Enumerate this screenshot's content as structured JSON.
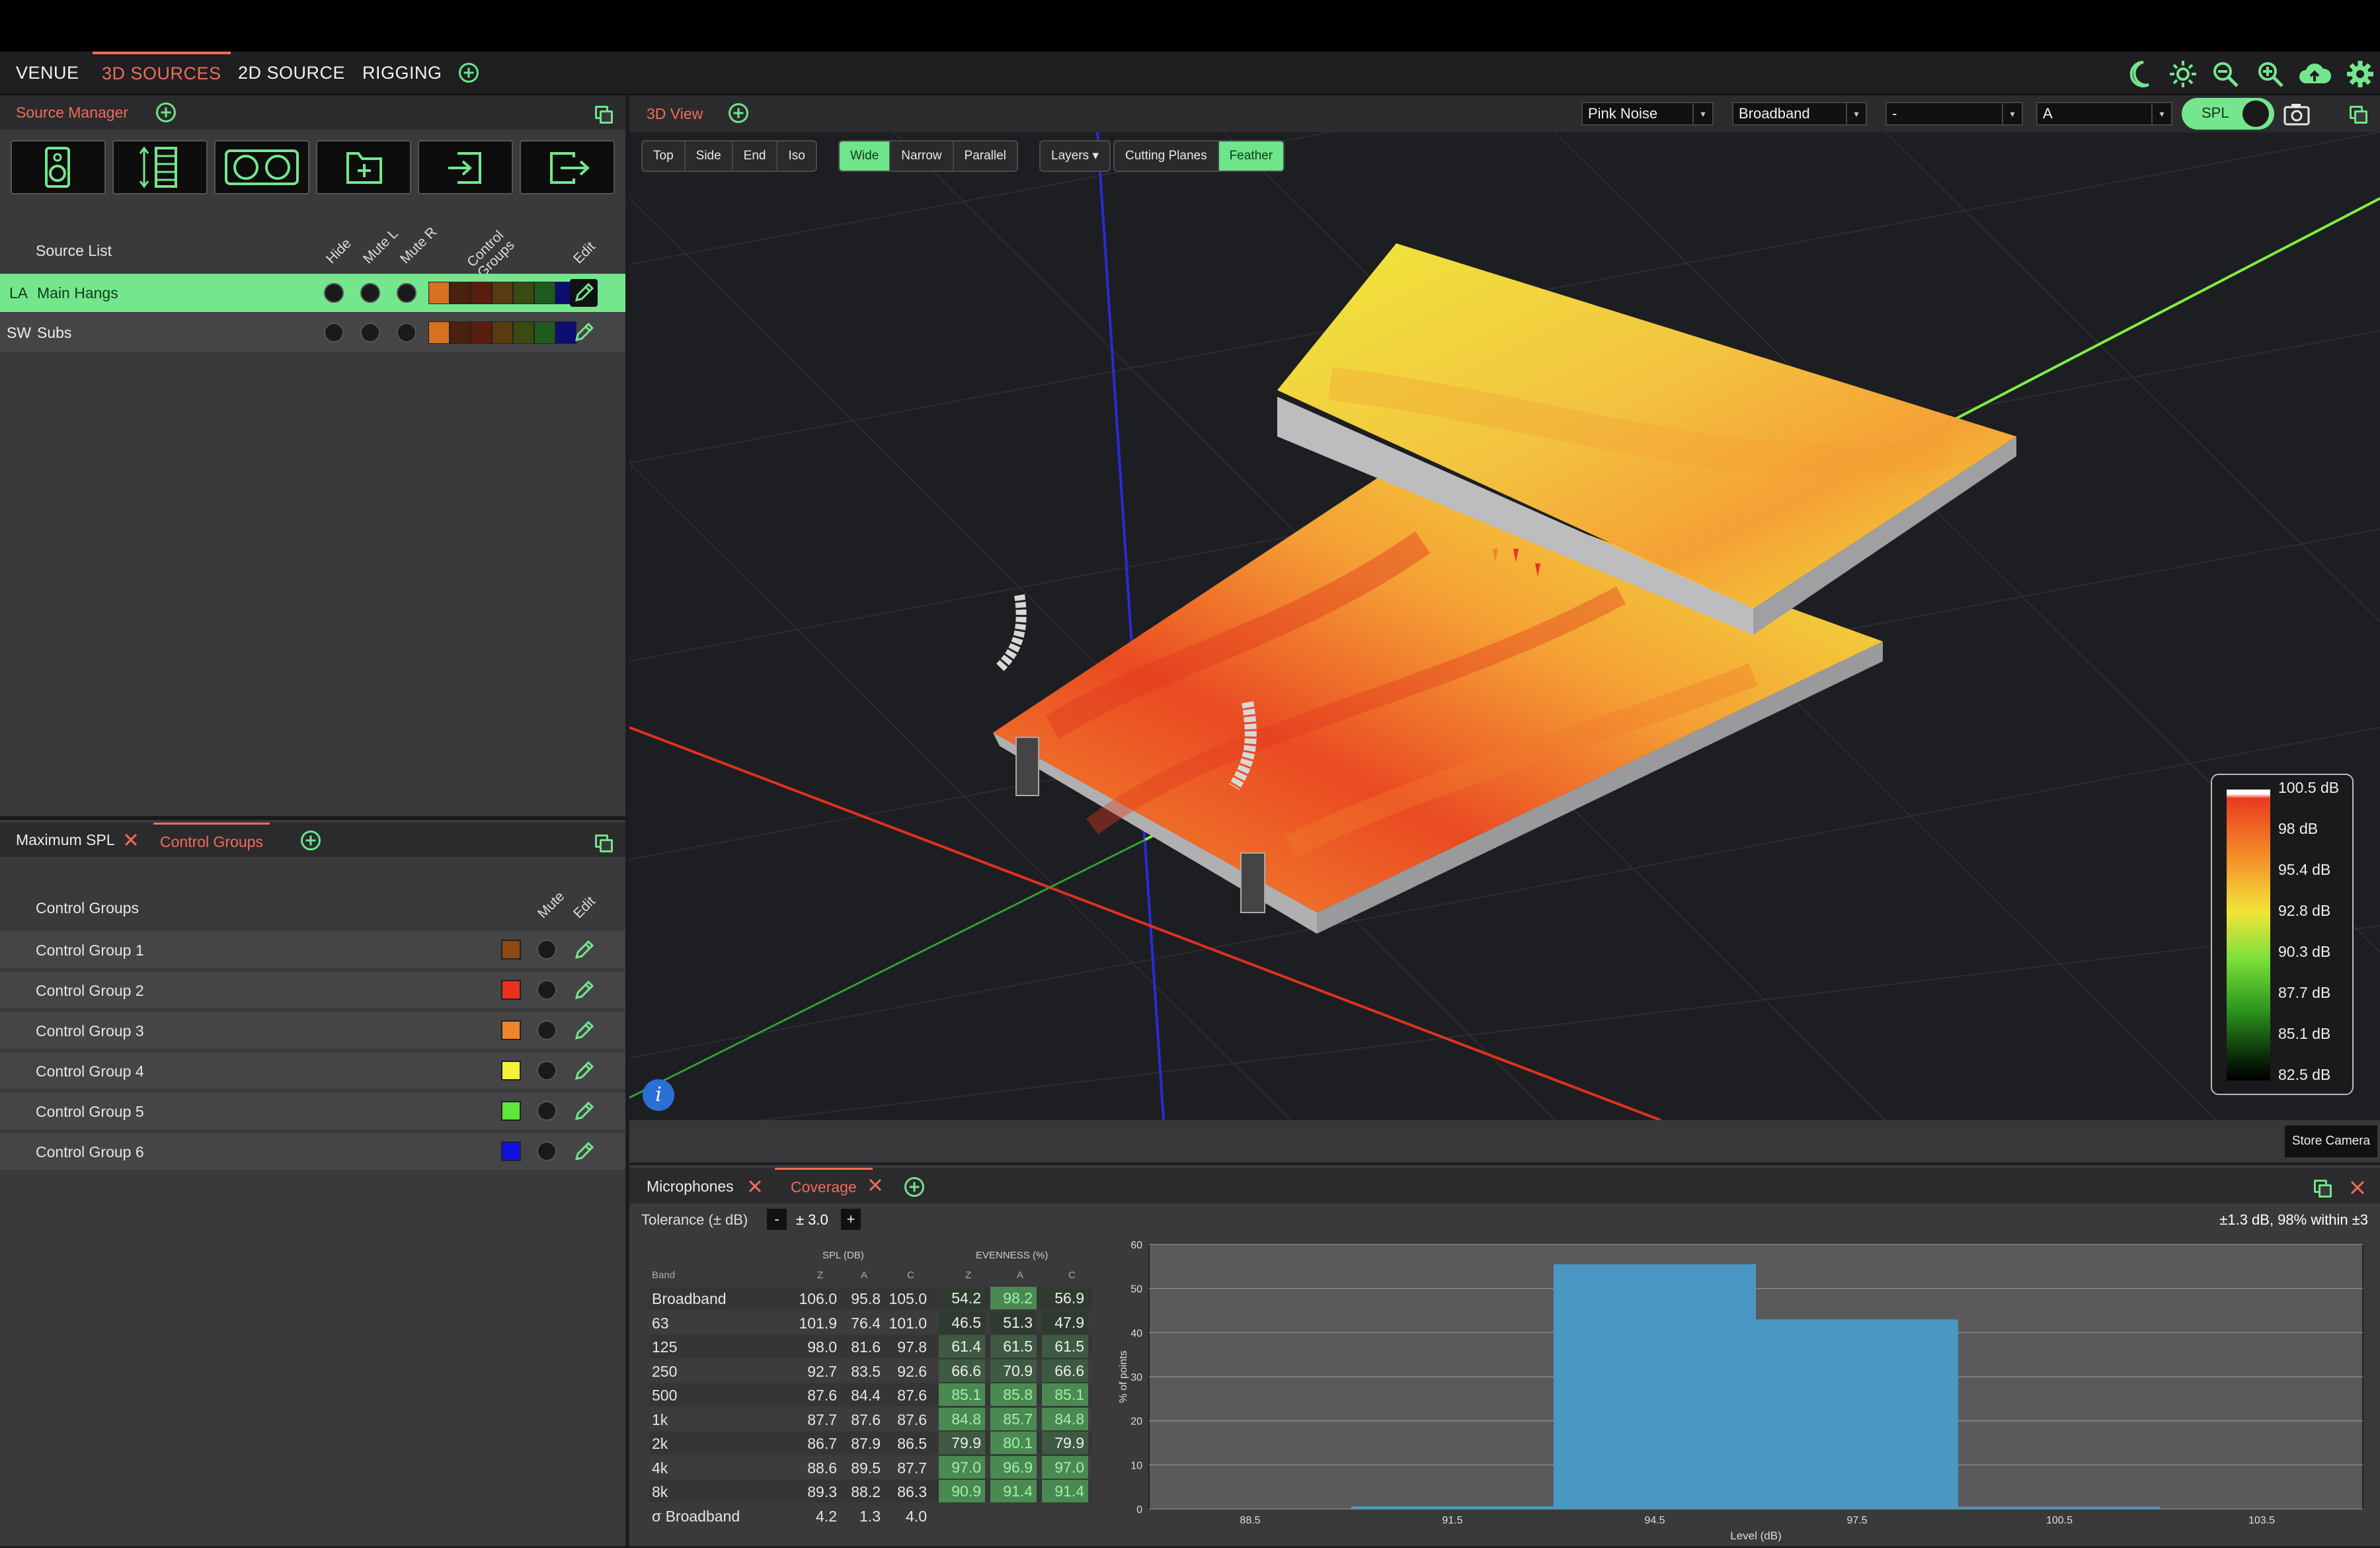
{
  "menu": {
    "items": [
      "VENUE",
      "3D SOURCES",
      "2D SOURCE",
      "RIGGING"
    ],
    "active": "3D SOURCES"
  },
  "top_icons": [
    "moon-icon",
    "sun-icon",
    "zoom-out-icon",
    "zoom-in-icon",
    "cloud-upload-icon",
    "gear-icon"
  ],
  "source_manager": {
    "tab": "Source Manager",
    "toolbar_icons": [
      "speaker-icon",
      "line-array-icon",
      "subwoofer-icon",
      "new-folder-icon",
      "import-icon",
      "export-icon"
    ],
    "list_title": "Source List",
    "headers": [
      "Hide",
      "Mute L",
      "Mute R",
      "Control Groups",
      "Edit"
    ],
    "rows": [
      {
        "prefix": "LA",
        "name": "Main Hangs",
        "selected": true
      },
      {
        "prefix": "SW",
        "name": "Subs",
        "selected": false
      }
    ],
    "group_colors": [
      "#d6711f",
      "#4a2010",
      "#5a1e10",
      "#5a3a10",
      "#3a4a10",
      "#1f5a1f",
      "#0d0d70"
    ]
  },
  "lower_left": {
    "tabs": [
      "Maximum SPL",
      "Control Groups"
    ],
    "active": "Control Groups",
    "list_title": "Control Groups",
    "headers": [
      "Mute",
      "Edit"
    ],
    "groups": [
      {
        "name": "Control Group 1",
        "color": "#8a4a10"
      },
      {
        "name": "Control Group 2",
        "color": "#e8321e"
      },
      {
        "name": "Control Group 3",
        "color": "#f0852a"
      },
      {
        "name": "Control Group 4",
        "color": "#f5f03a"
      },
      {
        "name": "Control Group 5",
        "color": "#5ee63a"
      },
      {
        "name": "Control Group 6",
        "color": "#1010e0"
      }
    ]
  },
  "view3d": {
    "tab": "3D View",
    "dropdowns": [
      "Pink Noise",
      "Broadband",
      "-",
      "A"
    ],
    "spl_toggle": "SPL",
    "view_buttons": [
      "Top",
      "Side",
      "End",
      "Iso"
    ],
    "beam_buttons": [
      "Wide",
      "Narrow",
      "Parallel"
    ],
    "beam_active": "Wide",
    "layers": "Layers",
    "cutting": "Cutting Planes",
    "feather": "Feather",
    "legend": [
      "100.5 dB",
      "98 dB",
      "95.4 dB",
      "92.8 dB",
      "90.3 dB",
      "87.7 dB",
      "85.1 dB",
      "82.5 dB"
    ],
    "store_camera": "Store Camera",
    "info_icon": "i"
  },
  "bottom": {
    "tabs": [
      "Microphones",
      "Coverage"
    ],
    "active": "Coverage",
    "tolerance_label": "Tolerance (± dB)",
    "tolerance_minus": "-",
    "tolerance_value": "± 3.0",
    "tolerance_plus": "+",
    "summary": "±1.3 dB, 98% within ±3",
    "table": {
      "spl_header": "SPL (DB)",
      "even_header": "EVENNESS (%)",
      "band_header": "Band",
      "weights": [
        "Z",
        "A",
        "C"
      ],
      "rows": [
        {
          "band": "Broadband",
          "spl": [
            "106.0",
            "95.8",
            "105.0"
          ],
          "even": [
            "54.2",
            "98.2",
            "56.9"
          ]
        },
        {
          "band": "63",
          "spl": [
            "101.9",
            "76.4",
            "101.0"
          ],
          "even": [
            "46.5",
            "51.3",
            "47.9"
          ]
        },
        {
          "band": "125",
          "spl": [
            "98.0",
            "81.6",
            "97.8"
          ],
          "even": [
            "61.4",
            "61.5",
            "61.5"
          ]
        },
        {
          "band": "250",
          "spl": [
            "92.7",
            "83.5",
            "92.6"
          ],
          "even": [
            "66.6",
            "70.9",
            "66.6"
          ]
        },
        {
          "band": "500",
          "spl": [
            "87.6",
            "84.4",
            "87.6"
          ],
          "even": [
            "85.1",
            "85.8",
            "85.1"
          ]
        },
        {
          "band": "1k",
          "spl": [
            "87.7",
            "87.6",
            "87.6"
          ],
          "even": [
            "84.8",
            "85.7",
            "84.8"
          ]
        },
        {
          "band": "2k",
          "spl": [
            "86.7",
            "87.9",
            "86.5"
          ],
          "even": [
            "79.9",
            "80.1",
            "79.9"
          ]
        },
        {
          "band": "4k",
          "spl": [
            "88.6",
            "89.5",
            "87.7"
          ],
          "even": [
            "97.0",
            "96.9",
            "97.0"
          ]
        },
        {
          "band": "8k",
          "spl": [
            "89.3",
            "88.2",
            "86.3"
          ],
          "even": [
            "90.9",
            "91.4",
            "91.4"
          ]
        }
      ],
      "sigma": {
        "band": "σ Broadband",
        "values": [
          "4.2",
          "1.3",
          "4.0"
        ]
      }
    }
  },
  "chart_data": {
    "type": "bar",
    "xlabel": "Level (dB)",
    "ylabel": "% of points",
    "x_ticks": [
      "88.5",
      "91.5",
      "94.5",
      "97.5",
      "100.5",
      "103.5"
    ],
    "y_ticks": [
      "0",
      "10",
      "20",
      "30",
      "40",
      "50",
      "60"
    ],
    "ylim": [
      0,
      60
    ],
    "xlim": [
      87,
      105
    ],
    "bins": [
      {
        "from": 90,
        "to": 93,
        "value": 0.6
      },
      {
        "from": 93,
        "to": 96,
        "value": 55.5
      },
      {
        "from": 96,
        "to": 99,
        "value": 43.0
      },
      {
        "from": 99,
        "to": 102,
        "value": 0.5
      }
    ],
    "color": "#4a97c4",
    "grid": true
  }
}
